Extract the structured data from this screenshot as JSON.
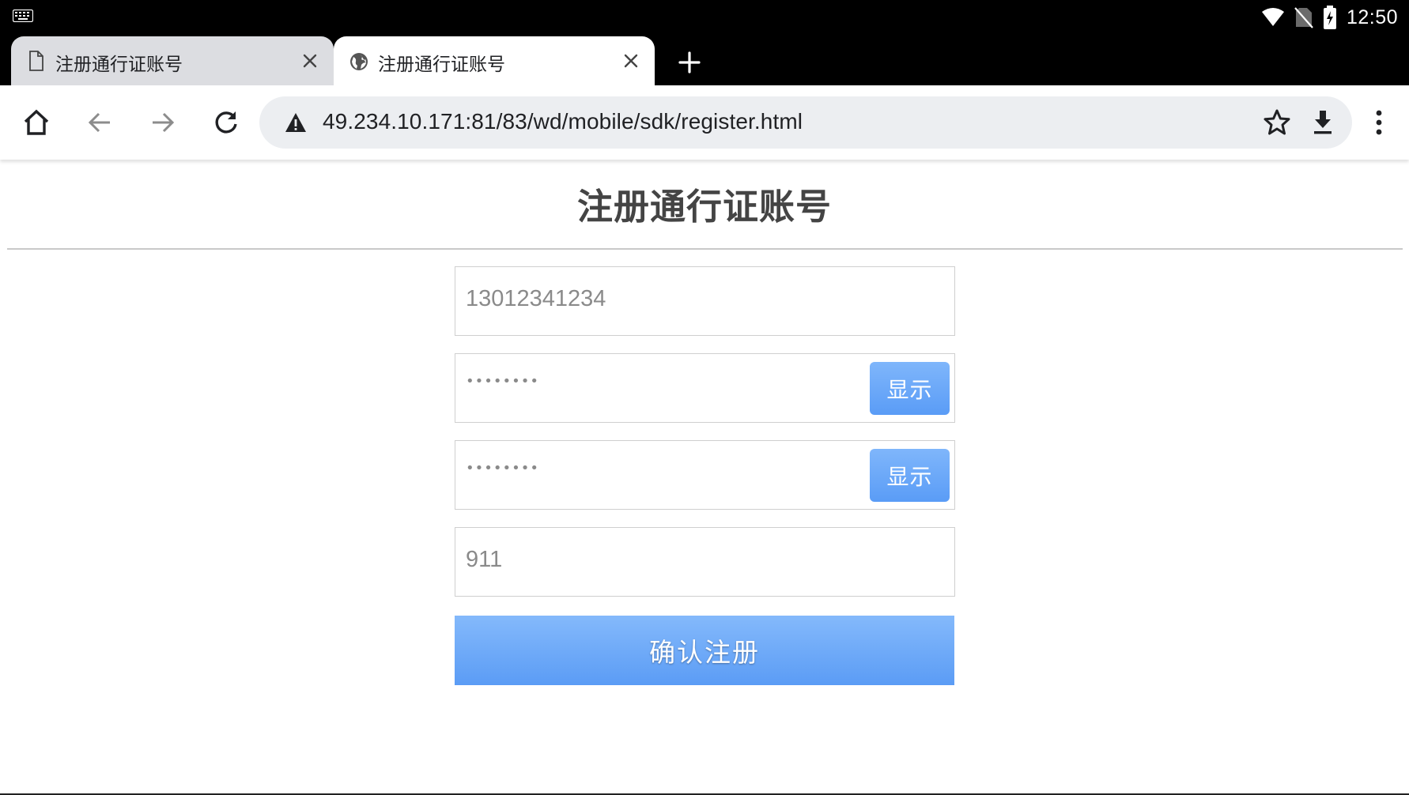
{
  "status_bar": {
    "time": "12:50",
    "icons": [
      "keyboard-icon",
      "wifi-icon",
      "no-sim-icon",
      "battery-charging-icon"
    ]
  },
  "tabs": [
    {
      "title": "注册通行证账号",
      "favicon": "document-icon",
      "active": false
    },
    {
      "title": "注册通行证账号",
      "favicon": "globe-icon",
      "active": true
    }
  ],
  "toolbar": {
    "url": "49.234.10.171:81/83/wd/mobile/sdk/register.html",
    "icons": [
      "home-icon",
      "back-arrow-icon",
      "forward-arrow-icon",
      "reload-icon",
      "warning-icon",
      "star-icon",
      "download-icon",
      "more-vert-icon"
    ]
  },
  "page": {
    "title": "注册通行证账号",
    "phone_value": "13012341234",
    "password_mask": "••••••••",
    "confirm_mask": "••••••••",
    "show_label": "显示",
    "code_value": "911",
    "submit_label": "确认注册"
  },
  "colors": {
    "button_blue": "#5a9cf6",
    "button_blue_light": "#84b9fb"
  }
}
